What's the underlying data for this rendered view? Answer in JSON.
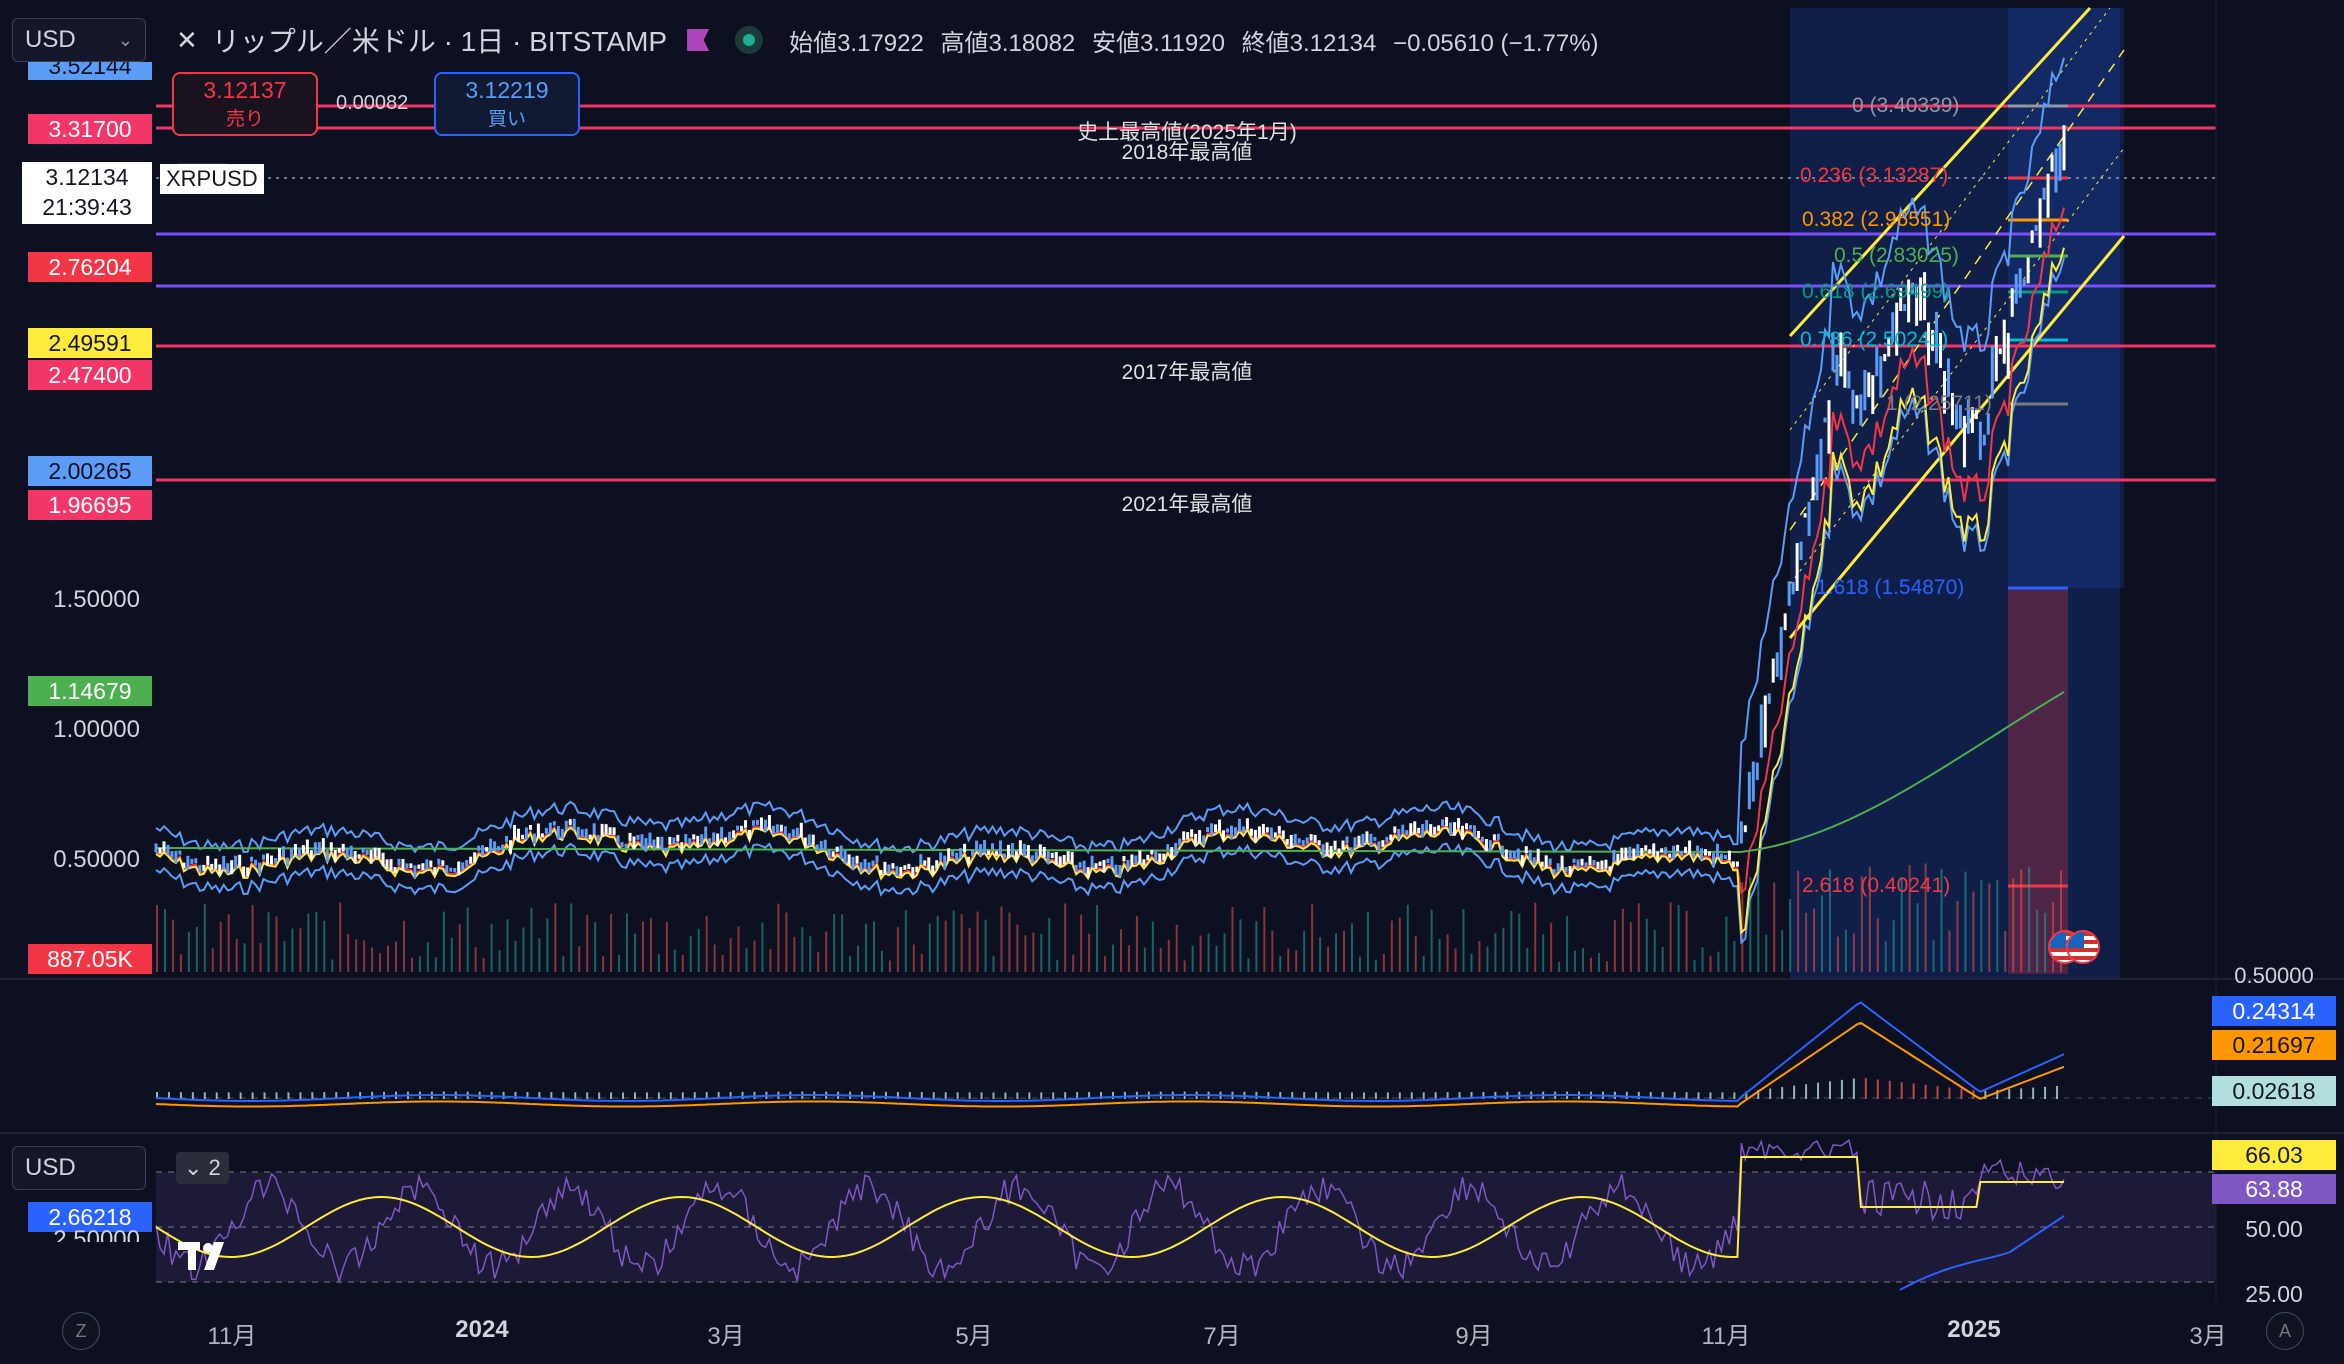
{
  "header": {
    "currency_select": "USD",
    "symbol_icon": "x-close-icon",
    "title": "リップル／米ドル · 1日 · BITSTAMP",
    "ohlc_open_label": "始値",
    "ohlc_open": "3.17922",
    "ohlc_high_label": "高値",
    "ohlc_high": "3.18082",
    "ohlc_low_label": "安値",
    "ohlc_low": "3.11920",
    "ohlc_close_label": "終値",
    "ohlc_close": "3.12134",
    "ohlc_change": "−0.05610 (−1.77%)"
  },
  "trade": {
    "sell_price": "3.12137",
    "sell_label": "売り",
    "spread": "0.00082",
    "buy_price": "3.12219",
    "buy_label": "買い"
  },
  "legend_chip": {
    "count": "7",
    "symbol": "XRPUSD"
  },
  "price_boxes": [
    {
      "text": "3.52144",
      "bg": "#5b9cf6",
      "fg": "#0c1020"
    },
    {
      "text": "3.31700",
      "bg": "#f23668",
      "fg": "#ffffff"
    },
    {
      "text": "2.76204",
      "bg": "#f23645",
      "fg": "#ffffff"
    },
    {
      "text": "2.49591",
      "bg": "#ffeb3b",
      "fg": "#131722"
    },
    {
      "text": "2.47400",
      "bg": "#f23668",
      "fg": "#ffffff"
    },
    {
      "text": "2.00265",
      "bg": "#5b9cf6",
      "fg": "#0c1020"
    },
    {
      "text": "1.96695",
      "bg": "#f23668",
      "fg": "#ffffff"
    },
    {
      "text": "1.14679",
      "bg": "#4caf50",
      "fg": "#ffffff"
    },
    {
      "text": "887.05K",
      "bg": "#f23645",
      "fg": "#ffffff"
    }
  ],
  "last_price": {
    "price": "3.12134",
    "countdown": "21:39:43"
  },
  "price_axis": [
    "1.50000",
    "1.00000",
    "0.50000"
  ],
  "annotations": [
    "史上最高値(2025年1月)",
    "2018年最高値",
    "2017年最高値",
    "2021年最高値"
  ],
  "fib_levels": [
    {
      "text": "0 (3.40339)",
      "color": "#9598a1"
    },
    {
      "text": "0.236 (3.13287)",
      "color": "#f23645"
    },
    {
      "text": "0.382 (2.96551)",
      "color": "#ff9800"
    },
    {
      "text": "0.5 (2.83025)",
      "color": "#4caf50"
    },
    {
      "text": "0.618 (2.69499)",
      "color": "#089981"
    },
    {
      "text": "0.786 (2.50241)",
      "color": "#00bcd4"
    },
    {
      "text": "1 (2.25711)",
      "color": "#787b86"
    },
    {
      "text": "1.618 (1.54870)",
      "color": "#2962ff"
    },
    {
      "text": "2.618 (0.40241)",
      "color": "#f23645"
    }
  ],
  "macd": {
    "axis_top": "0.50000",
    "macd_value": "0.24314",
    "signal_value": "0.21697",
    "hist_value": "0.02618",
    "colors": {
      "macd": "#2962ff",
      "signal": "#ff9800",
      "hist": "#b2dfdb"
    }
  },
  "rsi": {
    "currency_select": "USD",
    "chip_count": "2",
    "left_value": "2.66218",
    "left_axis": "2.50000",
    "rsi_value": "66.03",
    "rsi_ma_value": "63.88",
    "axis": [
      "50.00",
      "25.00"
    ]
  },
  "time_axis": [
    "11月",
    "2024",
    "3月",
    "5月",
    "7月",
    "9月",
    "11月",
    "2025",
    "3月"
  ],
  "corner_left": "Z",
  "corner_right": "A",
  "logo": "TV",
  "colors": {
    "up": "#ffffff",
    "down": "#5b9cf6",
    "hline": "#f23668",
    "purple": "#7c4dff",
    "channel": "#ffeb3b",
    "bb": "#5b9cf6",
    "ma_red": "#f23645",
    "ma_yellow": "#ffeb3b",
    "ma_green": "#4caf50"
  }
}
